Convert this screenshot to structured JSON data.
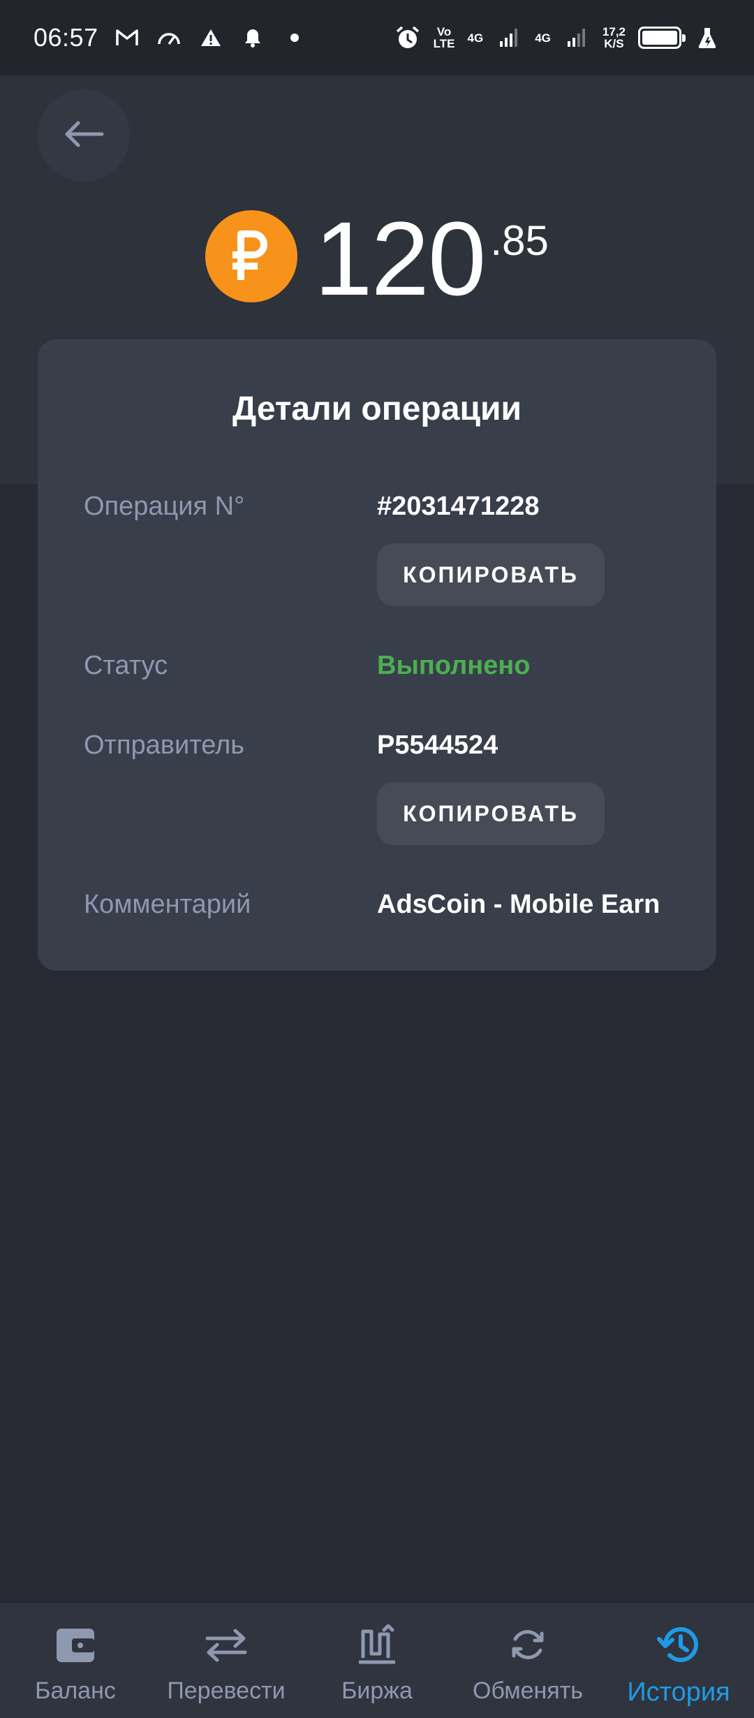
{
  "status_bar": {
    "time": "06:57",
    "volte_top": "Vo",
    "volte_bottom": "LTE",
    "net1": "4G",
    "net2": "4G",
    "speed_value": "17,2",
    "speed_unit": "K/S",
    "icons": [
      "gmail-icon",
      "speedometer-icon",
      "warning-icon",
      "bell-icon",
      "dot-icon",
      "alarm-icon",
      "signal-icon",
      "signal-icon",
      "battery-icon",
      "flask-icon"
    ]
  },
  "header": {
    "back_icon": "arrow-left-icon",
    "currency_icon": "ruble-icon",
    "amount_integer": "120",
    "amount_fraction": ".85"
  },
  "details": {
    "title": "Детали операции",
    "operation_label": "Операция N°",
    "operation_value": "#2031471228",
    "copy_label": "КОПИРОВАТЬ",
    "status_label": "Статус",
    "status_value": "Выполнено",
    "sender_label": "Отправитель",
    "sender_value": "P5544524",
    "comment_label": "Комментарий",
    "comment_value": "AdsCoin - Mobile Earn"
  },
  "colors": {
    "background": "#272a33",
    "card": "#393e4b",
    "accent": "#1e9be6",
    "coin": "#f7931a",
    "success": "#4caf50",
    "muted": "#8e99b0"
  },
  "bottom_nav": {
    "items": [
      {
        "label": "Баланс",
        "icon": "wallet-icon"
      },
      {
        "label": "Перевести",
        "icon": "transfer-arrows-icon"
      },
      {
        "label": "Биржа",
        "icon": "exchange-chart-icon"
      },
      {
        "label": "Обменять",
        "icon": "refresh-icon"
      },
      {
        "label": "История",
        "icon": "history-icon"
      }
    ],
    "active_index": 4
  }
}
